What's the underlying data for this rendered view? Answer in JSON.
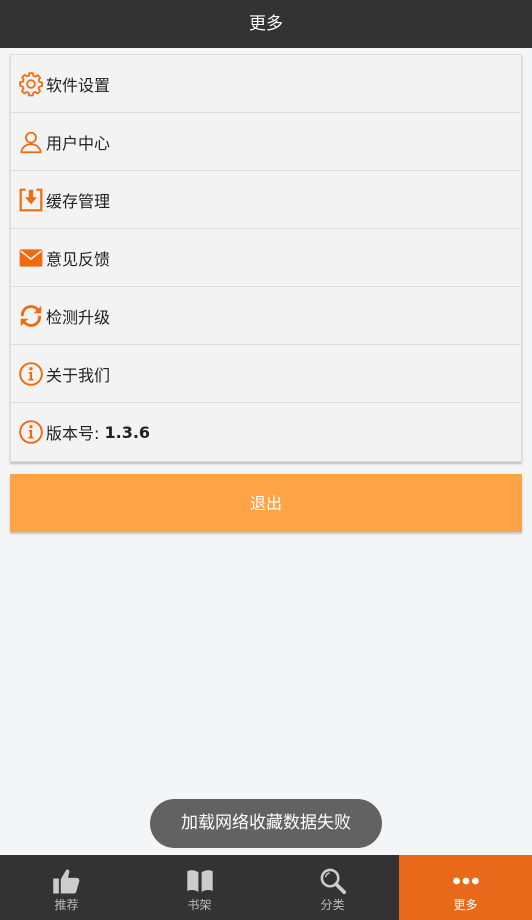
{
  "header": {
    "title": "更多"
  },
  "menu": {
    "items": [
      {
        "label": "软件设置",
        "icon": "gear-icon"
      },
      {
        "label": "用户中心",
        "icon": "user-icon"
      },
      {
        "label": "缓存管理",
        "icon": "download-icon"
      },
      {
        "label": "意见反馈",
        "icon": "envelope-icon"
      },
      {
        "label": "检测升级",
        "icon": "refresh-icon"
      },
      {
        "label": "关于我们",
        "icon": "info-icon"
      }
    ],
    "version": {
      "label": "版本号:",
      "value": "1.3.6",
      "icon": "info-icon"
    }
  },
  "logout": {
    "label": "退出"
  },
  "toast": {
    "message": "加载网络收藏数据失败"
  },
  "tabbar": {
    "tabs": [
      {
        "label": "推荐",
        "icon": "thumbs-up-icon"
      },
      {
        "label": "书架",
        "icon": "book-icon"
      },
      {
        "label": "分类",
        "icon": "search-icon"
      },
      {
        "label": "更多",
        "icon": "more-dots-icon",
        "active": true
      }
    ]
  },
  "colors": {
    "accent": "#e8691a",
    "icon": "#f26a0f",
    "button": "#ffa446",
    "header": "#333333"
  }
}
